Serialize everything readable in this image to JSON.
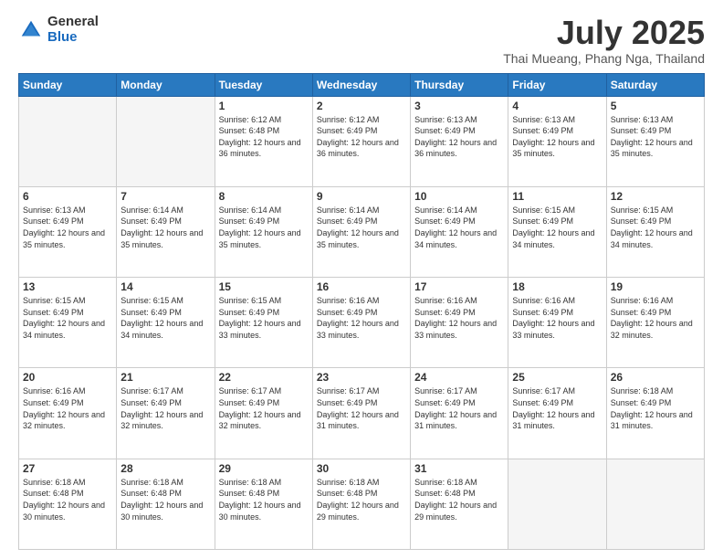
{
  "logo": {
    "general": "General",
    "blue": "Blue"
  },
  "header": {
    "month": "July 2025",
    "location": "Thai Mueang, Phang Nga, Thailand"
  },
  "days_of_week": [
    "Sunday",
    "Monday",
    "Tuesday",
    "Wednesday",
    "Thursday",
    "Friday",
    "Saturday"
  ],
  "weeks": [
    [
      {
        "day": "",
        "sunrise": "",
        "sunset": "",
        "daylight": "",
        "empty": true
      },
      {
        "day": "",
        "sunrise": "",
        "sunset": "",
        "daylight": "",
        "empty": true
      },
      {
        "day": "1",
        "sunrise": "Sunrise: 6:12 AM",
        "sunset": "Sunset: 6:48 PM",
        "daylight": "Daylight: 12 hours and 36 minutes.",
        "empty": false
      },
      {
        "day": "2",
        "sunrise": "Sunrise: 6:12 AM",
        "sunset": "Sunset: 6:49 PM",
        "daylight": "Daylight: 12 hours and 36 minutes.",
        "empty": false
      },
      {
        "day": "3",
        "sunrise": "Sunrise: 6:13 AM",
        "sunset": "Sunset: 6:49 PM",
        "daylight": "Daylight: 12 hours and 36 minutes.",
        "empty": false
      },
      {
        "day": "4",
        "sunrise": "Sunrise: 6:13 AM",
        "sunset": "Sunset: 6:49 PM",
        "daylight": "Daylight: 12 hours and 35 minutes.",
        "empty": false
      },
      {
        "day": "5",
        "sunrise": "Sunrise: 6:13 AM",
        "sunset": "Sunset: 6:49 PM",
        "daylight": "Daylight: 12 hours and 35 minutes.",
        "empty": false
      }
    ],
    [
      {
        "day": "6",
        "sunrise": "Sunrise: 6:13 AM",
        "sunset": "Sunset: 6:49 PM",
        "daylight": "Daylight: 12 hours and 35 minutes.",
        "empty": false
      },
      {
        "day": "7",
        "sunrise": "Sunrise: 6:14 AM",
        "sunset": "Sunset: 6:49 PM",
        "daylight": "Daylight: 12 hours and 35 minutes.",
        "empty": false
      },
      {
        "day": "8",
        "sunrise": "Sunrise: 6:14 AM",
        "sunset": "Sunset: 6:49 PM",
        "daylight": "Daylight: 12 hours and 35 minutes.",
        "empty": false
      },
      {
        "day": "9",
        "sunrise": "Sunrise: 6:14 AM",
        "sunset": "Sunset: 6:49 PM",
        "daylight": "Daylight: 12 hours and 35 minutes.",
        "empty": false
      },
      {
        "day": "10",
        "sunrise": "Sunrise: 6:14 AM",
        "sunset": "Sunset: 6:49 PM",
        "daylight": "Daylight: 12 hours and 34 minutes.",
        "empty": false
      },
      {
        "day": "11",
        "sunrise": "Sunrise: 6:15 AM",
        "sunset": "Sunset: 6:49 PM",
        "daylight": "Daylight: 12 hours and 34 minutes.",
        "empty": false
      },
      {
        "day": "12",
        "sunrise": "Sunrise: 6:15 AM",
        "sunset": "Sunset: 6:49 PM",
        "daylight": "Daylight: 12 hours and 34 minutes.",
        "empty": false
      }
    ],
    [
      {
        "day": "13",
        "sunrise": "Sunrise: 6:15 AM",
        "sunset": "Sunset: 6:49 PM",
        "daylight": "Daylight: 12 hours and 34 minutes.",
        "empty": false
      },
      {
        "day": "14",
        "sunrise": "Sunrise: 6:15 AM",
        "sunset": "Sunset: 6:49 PM",
        "daylight": "Daylight: 12 hours and 34 minutes.",
        "empty": false
      },
      {
        "day": "15",
        "sunrise": "Sunrise: 6:15 AM",
        "sunset": "Sunset: 6:49 PM",
        "daylight": "Daylight: 12 hours and 33 minutes.",
        "empty": false
      },
      {
        "day": "16",
        "sunrise": "Sunrise: 6:16 AM",
        "sunset": "Sunset: 6:49 PM",
        "daylight": "Daylight: 12 hours and 33 minutes.",
        "empty": false
      },
      {
        "day": "17",
        "sunrise": "Sunrise: 6:16 AM",
        "sunset": "Sunset: 6:49 PM",
        "daylight": "Daylight: 12 hours and 33 minutes.",
        "empty": false
      },
      {
        "day": "18",
        "sunrise": "Sunrise: 6:16 AM",
        "sunset": "Sunset: 6:49 PM",
        "daylight": "Daylight: 12 hours and 33 minutes.",
        "empty": false
      },
      {
        "day": "19",
        "sunrise": "Sunrise: 6:16 AM",
        "sunset": "Sunset: 6:49 PM",
        "daylight": "Daylight: 12 hours and 32 minutes.",
        "empty": false
      }
    ],
    [
      {
        "day": "20",
        "sunrise": "Sunrise: 6:16 AM",
        "sunset": "Sunset: 6:49 PM",
        "daylight": "Daylight: 12 hours and 32 minutes.",
        "empty": false
      },
      {
        "day": "21",
        "sunrise": "Sunrise: 6:17 AM",
        "sunset": "Sunset: 6:49 PM",
        "daylight": "Daylight: 12 hours and 32 minutes.",
        "empty": false
      },
      {
        "day": "22",
        "sunrise": "Sunrise: 6:17 AM",
        "sunset": "Sunset: 6:49 PM",
        "daylight": "Daylight: 12 hours and 32 minutes.",
        "empty": false
      },
      {
        "day": "23",
        "sunrise": "Sunrise: 6:17 AM",
        "sunset": "Sunset: 6:49 PM",
        "daylight": "Daylight: 12 hours and 31 minutes.",
        "empty": false
      },
      {
        "day": "24",
        "sunrise": "Sunrise: 6:17 AM",
        "sunset": "Sunset: 6:49 PM",
        "daylight": "Daylight: 12 hours and 31 minutes.",
        "empty": false
      },
      {
        "day": "25",
        "sunrise": "Sunrise: 6:17 AM",
        "sunset": "Sunset: 6:49 PM",
        "daylight": "Daylight: 12 hours and 31 minutes.",
        "empty": false
      },
      {
        "day": "26",
        "sunrise": "Sunrise: 6:18 AM",
        "sunset": "Sunset: 6:49 PM",
        "daylight": "Daylight: 12 hours and 31 minutes.",
        "empty": false
      }
    ],
    [
      {
        "day": "27",
        "sunrise": "Sunrise: 6:18 AM",
        "sunset": "Sunset: 6:48 PM",
        "daylight": "Daylight: 12 hours and 30 minutes.",
        "empty": false
      },
      {
        "day": "28",
        "sunrise": "Sunrise: 6:18 AM",
        "sunset": "Sunset: 6:48 PM",
        "daylight": "Daylight: 12 hours and 30 minutes.",
        "empty": false
      },
      {
        "day": "29",
        "sunrise": "Sunrise: 6:18 AM",
        "sunset": "Sunset: 6:48 PM",
        "daylight": "Daylight: 12 hours and 30 minutes.",
        "empty": false
      },
      {
        "day": "30",
        "sunrise": "Sunrise: 6:18 AM",
        "sunset": "Sunset: 6:48 PM",
        "daylight": "Daylight: 12 hours and 29 minutes.",
        "empty": false
      },
      {
        "day": "31",
        "sunrise": "Sunrise: 6:18 AM",
        "sunset": "Sunset: 6:48 PM",
        "daylight": "Daylight: 12 hours and 29 minutes.",
        "empty": false
      },
      {
        "day": "",
        "sunrise": "",
        "sunset": "",
        "daylight": "",
        "empty": true
      },
      {
        "day": "",
        "sunrise": "",
        "sunset": "",
        "daylight": "",
        "empty": true
      }
    ]
  ]
}
